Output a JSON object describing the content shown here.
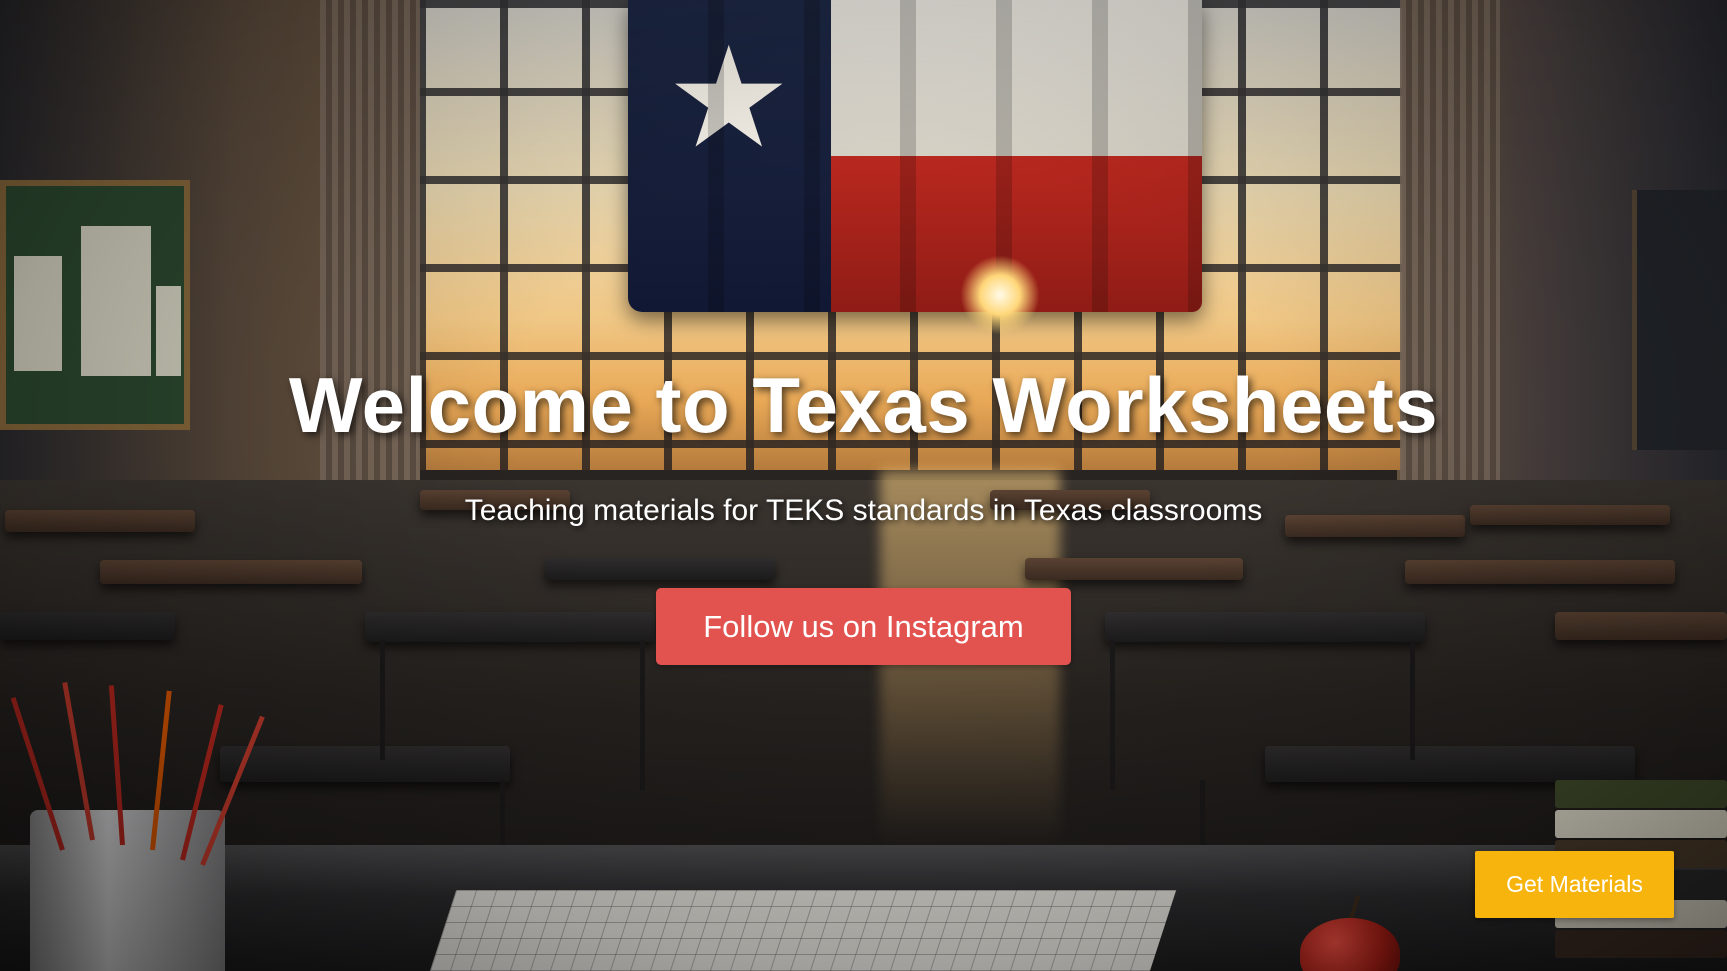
{
  "hero": {
    "title": "Welcome to Texas Worksheets",
    "subtitle": "Teaching materials for TEKS standards in Texas classrooms",
    "background_image": "classroom-texas-flag-image"
  },
  "buttons": {
    "instagram_label": "Follow us on Instagram",
    "get_materials_label": "Get Materials"
  },
  "colors": {
    "instagram_button": "#e2524e",
    "get_materials_button": "#f6b40d",
    "text": "#ffffff"
  }
}
